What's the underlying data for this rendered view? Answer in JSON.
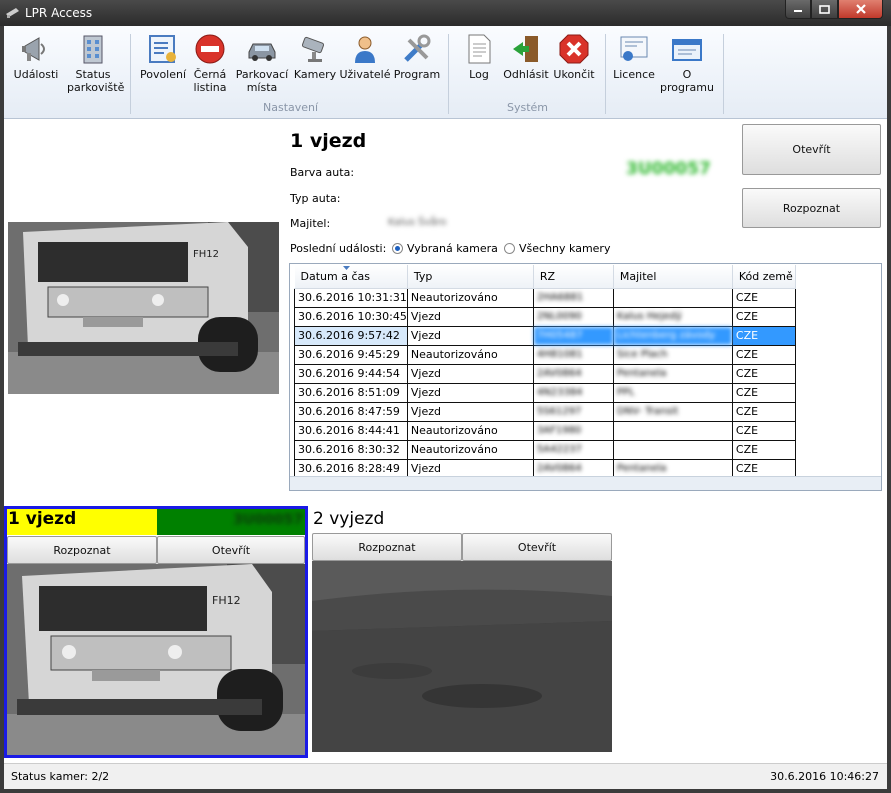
{
  "window": {
    "title": "LPR Access"
  },
  "ribbon": {
    "buttons": [
      {
        "label": "Události",
        "icon": "megaphone-icon"
      },
      {
        "label": "Status parkoviště",
        "icon": "building-icon"
      },
      {
        "label": "Povolení",
        "icon": "permit-list-icon"
      },
      {
        "label": "Černá listina",
        "icon": "no-entry-icon"
      },
      {
        "label": "Parkovací místa",
        "icon": "car-icon"
      },
      {
        "label": "Kamery",
        "icon": "camera-icon"
      },
      {
        "label": "Uživatelé",
        "icon": "user-icon"
      },
      {
        "label": "Program",
        "icon": "tools-icon"
      },
      {
        "label": "Log",
        "icon": "document-icon"
      },
      {
        "label": "Odhlásit",
        "icon": "logout-door-icon"
      },
      {
        "label": "Ukončit",
        "icon": "exit-x-icon"
      },
      {
        "label": "Licence",
        "icon": "certificate-icon"
      },
      {
        "label": "O programu",
        "icon": "about-window-icon"
      }
    ],
    "groups": {
      "settings": "Nastavení",
      "system": "Systém"
    }
  },
  "detail": {
    "title": "1 vjezd",
    "plate": "3U00057",
    "car_color_label": "Barva auta:",
    "car_type_label": "Typ auta:",
    "owner_label": "Majitel:",
    "owner_value": "Kalus Švåro",
    "last_events_label": "Poslední události:",
    "radio_selected_camera": "Vybraná kamera",
    "radio_all_cameras": "Všechny kamery",
    "open_button": "Otevřít",
    "recognize_button": "Rozpoznat"
  },
  "table": {
    "columns": [
      "Datum a čas",
      "Typ",
      "RZ",
      "Majitel",
      "Kód země"
    ],
    "rows": [
      [
        "30.6.2016 10:31:31",
        "Neautorizováno",
        "2HA6881",
        "",
        "CZE"
      ],
      [
        "30.6.2016 10:30:45",
        "Vjezd",
        "2NL0090",
        "Kalus Hejedý",
        "CZE"
      ],
      [
        "30.6.2016 9:57:42",
        "Vjezd",
        "7H05487",
        "Lichtenberg závody",
        "CZE"
      ],
      [
        "30.6.2016 9:45:29",
        "Neautorizováno",
        "4H81081",
        "Sice Plach",
        "CZE"
      ],
      [
        "30.6.2016 9:44:54",
        "Vjezd",
        "2AV0864",
        "Pentanela",
        "CZE"
      ],
      [
        "30.6.2016 8:51:09",
        "Vjezd",
        "4N23384",
        "PPL",
        "CZE"
      ],
      [
        "30.6.2016 8:47:59",
        "Vjezd",
        "5S61297",
        "DNV- Transit",
        "CZE"
      ],
      [
        "30.6.2016 8:44:41",
        "Neautorizováno",
        "3AF1980",
        "",
        "CZE"
      ],
      [
        "30.6.2016 8:30:32",
        "Neautorizováno",
        "5A42237",
        "",
        "CZE"
      ],
      [
        "30.6.2016 8:28:49",
        "Vjezd",
        "2AV0864",
        "Pentanela",
        "CZE"
      ]
    ],
    "selected_row": 2
  },
  "cameras": [
    {
      "name": "1 vjezd",
      "plate": "3U00057",
      "recognize": "Rozpoznat",
      "open": "Otevřít"
    },
    {
      "name": "2 vyjezd",
      "recognize": "Rozpoznat",
      "open": "Otevřít"
    }
  ],
  "status": {
    "cameras": "Status kamer: 2/2",
    "datetime": "30.6.2016 10:46:27"
  },
  "colors": {
    "active_camera_border": "#1a1ae6",
    "cam_name_bg": "#ffff00",
    "cam_plate_bg": "#008000",
    "selection": "#3399ff"
  }
}
